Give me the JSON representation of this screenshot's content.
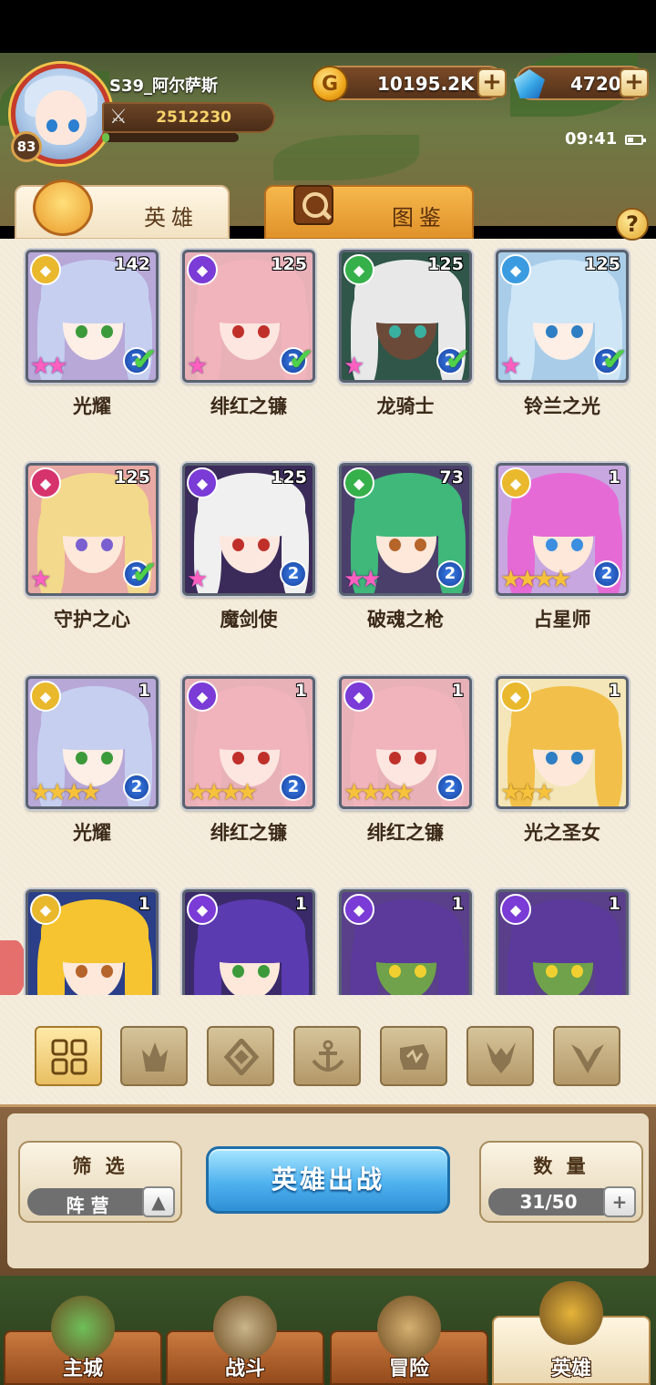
{
  "player": {
    "name": "S39_阿尔萨斯",
    "level": "83",
    "power": "2512230",
    "exp_fraction": 0.05
  },
  "resources": {
    "gold": "10195.2K",
    "gems": "4720"
  },
  "status": {
    "time": "09:41"
  },
  "tabs": [
    {
      "label": "英雄"
    },
    {
      "label": "图鉴"
    }
  ],
  "help_label": "?",
  "heroes": [
    {
      "name": "光耀",
      "level": "142",
      "faction": "light",
      "stars": 2,
      "rainbow": true,
      "grade": "2",
      "deployed": true,
      "hair": "#c6cff0",
      "skin": "#fdeee6",
      "eye": "#3c9a3a",
      "bg": "#b7a8d8"
    },
    {
      "name": "绯红之镰",
      "level": "125",
      "faction": "dark",
      "stars": 1,
      "rainbow": true,
      "grade": "2",
      "deployed": true,
      "hair": "#f2b4bc",
      "skin": "#fde5e0",
      "eye": "#c0302a",
      "bg": "#e8b1b8"
    },
    {
      "name": "龙骑士",
      "level": "125",
      "faction": "nature",
      "stars": 1,
      "rainbow": true,
      "grade": "2",
      "deployed": true,
      "hair": "#e8e8e8",
      "skin": "#6b4a3a",
      "eye": "#3ab0a0",
      "bg": "#2f5648"
    },
    {
      "name": "铃兰之光",
      "level": "125",
      "faction": "water",
      "stars": 1,
      "rainbow": true,
      "grade": "2",
      "deployed": true,
      "hair": "#cfe6f7",
      "skin": "#fdeee6",
      "eye": "#2e7ec4",
      "bg": "#a9cde8"
    },
    {
      "name": "守护之心",
      "level": "125",
      "faction": "fire",
      "stars": 1,
      "rainbow": true,
      "grade": "2",
      "deployed": true,
      "hair": "#f3d98c",
      "skin": "#fde8da",
      "eye": "#7a5fd0",
      "bg": "#e9a9a4"
    },
    {
      "name": "魔剑使",
      "level": "125",
      "faction": "dark",
      "stars": 1,
      "rainbow": true,
      "grade": "2",
      "deployed": false,
      "hair": "#f0f0f0",
      "skin": "#fde8e0",
      "eye": "#c0302a",
      "bg": "#3b2b5a"
    },
    {
      "name": "破魂之枪",
      "level": "73",
      "faction": "nature",
      "stars": 2,
      "rainbow": true,
      "grade": "2",
      "deployed": false,
      "hair": "#3fb87a",
      "skin": "#fde8da",
      "eye": "#b5642a",
      "bg": "#4a3f6b"
    },
    {
      "name": "占星师",
      "level": "1",
      "faction": "light",
      "stars": 4,
      "rainbow": false,
      "grade": "2",
      "deployed": false,
      "hair": "#e56ad6",
      "skin": "#fde8da",
      "eye": "#3b8ee0",
      "bg": "#c8a6e0"
    },
    {
      "name": "光耀",
      "level": "1",
      "faction": "light",
      "stars": 4,
      "rainbow": false,
      "grade": "2",
      "deployed": false,
      "hair": "#c6cff0",
      "skin": "#fdeee6",
      "eye": "#3c9a3a",
      "bg": "#b7a8d8"
    },
    {
      "name": "绯红之镰",
      "level": "1",
      "faction": "dark",
      "stars": 4,
      "rainbow": false,
      "grade": "2",
      "deployed": false,
      "hair": "#f2b4bc",
      "skin": "#fde5e0",
      "eye": "#c0302a",
      "bg": "#e8b1b8"
    },
    {
      "name": "绯红之镰",
      "level": "1",
      "faction": "dark",
      "stars": 4,
      "rainbow": false,
      "grade": "2",
      "deployed": false,
      "hair": "#f2b4bc",
      "skin": "#fde5e0",
      "eye": "#c0302a",
      "bg": "#e8b1b8"
    },
    {
      "name": "光之圣女",
      "level": "1",
      "faction": "light",
      "stars": 3,
      "rainbow": false,
      "grade": "",
      "deployed": false,
      "hair": "#f2c04a",
      "skin": "#fde8da",
      "eye": "#2e7ec4",
      "bg": "#f4e6b8"
    },
    {
      "name": "",
      "level": "1",
      "faction": "light",
      "stars": 0,
      "rainbow": false,
      "grade": "",
      "deployed": false,
      "hair": "#f5c430",
      "skin": "#fde8da",
      "eye": "#b5642a",
      "bg": "#2a3f88"
    },
    {
      "name": "",
      "level": "1",
      "faction": "dark",
      "stars": 0,
      "rainbow": false,
      "grade": "",
      "deployed": false,
      "hair": "#5a3bb0",
      "skin": "#fde8da",
      "eye": "#3c9a3a",
      "bg": "#3a2a6a"
    },
    {
      "name": "",
      "level": "1",
      "faction": "dark",
      "stars": 0,
      "rainbow": false,
      "grade": "",
      "deployed": false,
      "hair": "#5b3a9c",
      "skin": "#6fa24a",
      "eye": "#f0d030",
      "bg": "#5a3f8a"
    },
    {
      "name": "",
      "level": "1",
      "faction": "dark",
      "stars": 0,
      "rainbow": false,
      "grade": "",
      "deployed": false,
      "hair": "#5b3a9c",
      "skin": "#6fa24a",
      "eye": "#f0d030",
      "bg": "#5a3f8a"
    }
  ],
  "faction_colors": {
    "light": "#e9b82c",
    "dark": "#7a3bd6",
    "nature": "#36b04a",
    "water": "#3a9be0",
    "fire": "#d6336d"
  },
  "filters": [
    {
      "icon": "all-icon",
      "active": true
    },
    {
      "icon": "fire-faction-icon",
      "active": false
    },
    {
      "icon": "water-faction-icon",
      "active": false
    },
    {
      "icon": "anchor-faction-icon",
      "active": false
    },
    {
      "icon": "nature-faction-icon",
      "active": false
    },
    {
      "icon": "dark-faction-icon",
      "active": false
    },
    {
      "icon": "light-faction-icon",
      "active": false
    }
  ],
  "filter_box": {
    "title": "筛 选",
    "value": "阵 营",
    "toggle": "▲"
  },
  "deploy_button": "英雄出战",
  "count_box": {
    "title": "数 量",
    "value": "31/50",
    "plus": "+"
  },
  "nav": [
    {
      "label": "主城",
      "active": false,
      "color": "#6fbf5a"
    },
    {
      "label": "战斗",
      "active": false,
      "color": "#c9b48a"
    },
    {
      "label": "冒险",
      "active": false,
      "color": "#d6b072"
    },
    {
      "label": "英雄",
      "active": true,
      "color": "#e6b43a"
    }
  ],
  "plus_label": "+",
  "coin_glyph": "G"
}
